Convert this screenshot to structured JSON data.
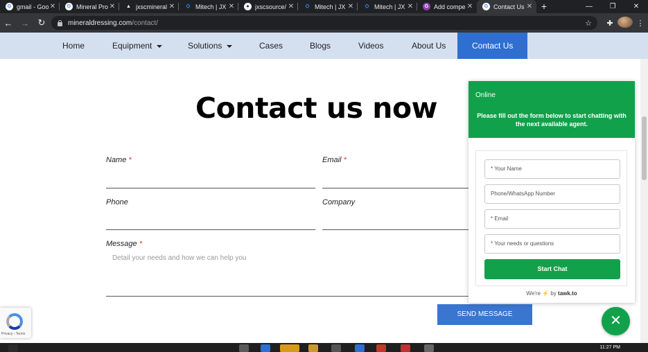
{
  "tabs": [
    {
      "title": "gmail - Goo",
      "icon": "google-icon",
      "color": "#4285f4",
      "glyph": "G"
    },
    {
      "title": "Mineral Pro",
      "icon": "google-icon",
      "color": "#4285f4",
      "glyph": "G"
    },
    {
      "title": "jxscmineral",
      "icon": "drive-icon",
      "color": "#f4b400",
      "glyph": "▲"
    },
    {
      "title": "Mitech | JX",
      "icon": "jira-icon",
      "color": "#2684ff",
      "glyph": "⛭"
    },
    {
      "title": "jxscsource/",
      "icon": "github-icon",
      "color": "#ffffff",
      "glyph": "●"
    },
    {
      "title": "Mitech | JX",
      "icon": "jira-icon",
      "color": "#2684ff",
      "glyph": "⛭"
    },
    {
      "title": "Mitech | JX",
      "icon": "jira-icon",
      "color": "#2684ff",
      "glyph": "⛭"
    },
    {
      "title": "Add compe",
      "icon": "add-icon",
      "color": "#8e44ad",
      "glyph": "G"
    },
    {
      "title": "Contact Us",
      "icon": "google-icon",
      "color": "#4285f4",
      "glyph": "G",
      "active": true
    }
  ],
  "browser": {
    "url_host": "mineraldressing.com",
    "url_path": "/contact/"
  },
  "nav": {
    "home": "Home",
    "equipment": "Equipment",
    "solutions": "Solutions",
    "cases": "Cases",
    "blogs": "Blogs",
    "videos": "Videos",
    "about": "About Us",
    "contact": "Contact Us"
  },
  "page": {
    "heading": "Contact us now",
    "name_label": "Name",
    "email_label": "Email",
    "phone_label": "Phone",
    "company_label": "Company",
    "message_label": "Message",
    "required_mark": "*",
    "message_placeholder": "Detail your needs and how we can help you",
    "send_label": "SEND MESSAGE"
  },
  "chat": {
    "status": "Online",
    "message": "Please fill out the form below to start chatting with the next available agent.",
    "name_placeholder": "* Your Name",
    "phone_placeholder": "Phone/WhatsApp Number",
    "email_placeholder": "* Email",
    "needs_placeholder": "* Your needs or questions",
    "start_label": "Start Chat",
    "powered_prefix": "We're",
    "powered_by": "by",
    "powered_brand": "tawk.to",
    "accent": "#12a14b"
  },
  "recaptcha": {
    "text": "Privacy - Terms"
  },
  "taskbar": {
    "clock": "11:27 PM"
  }
}
